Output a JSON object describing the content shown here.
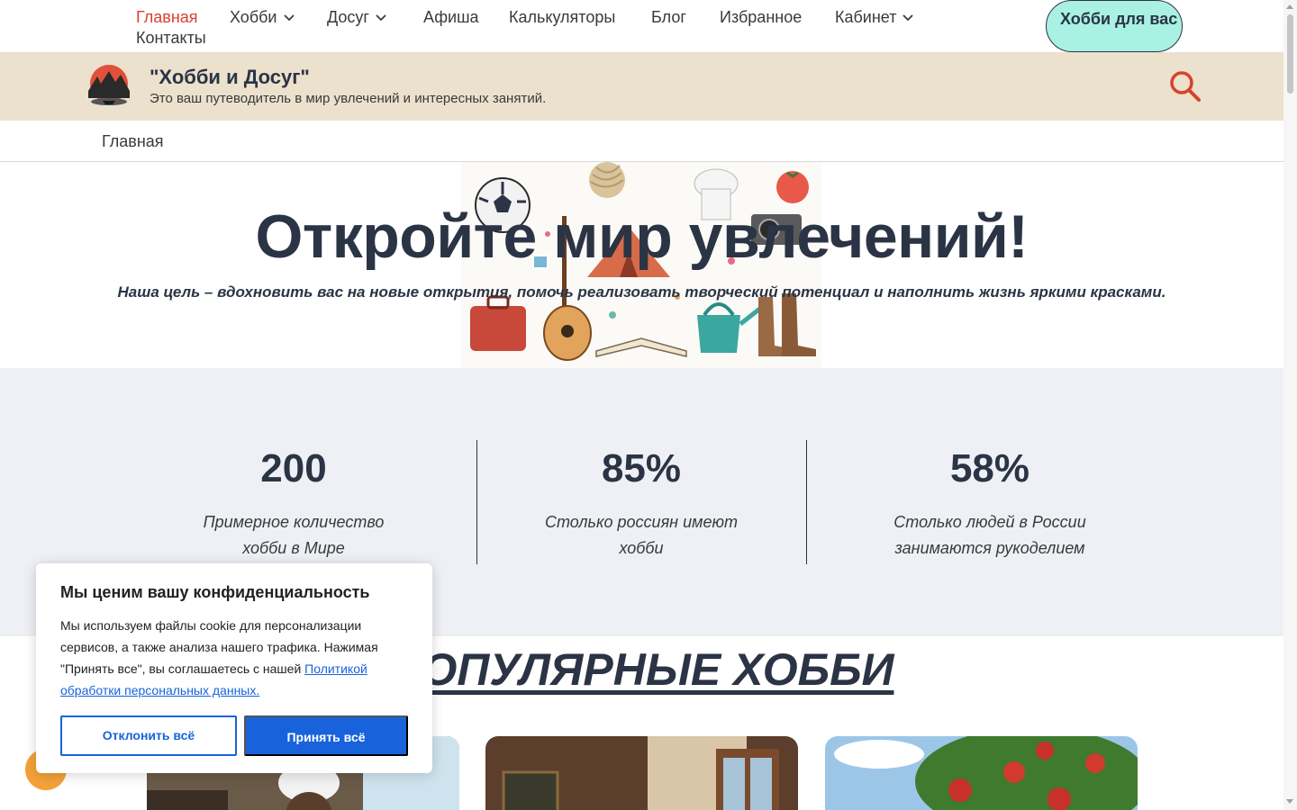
{
  "nav": {
    "items": [
      {
        "label": "Главная",
        "active": true
      },
      {
        "label": "Хобби",
        "has_dropdown": true
      },
      {
        "label": "Досуг",
        "has_dropdown": true
      },
      {
        "label": "Афиша"
      },
      {
        "label": "Калькуляторы"
      },
      {
        "label": "Блог"
      },
      {
        "label": "Избранное"
      },
      {
        "label": "Кабинет",
        "has_dropdown": true
      },
      {
        "label": "Контакты"
      }
    ],
    "cta_label": "Хобби для вас"
  },
  "header": {
    "site_title": "\"Хобби и Досуг\"",
    "site_description": "Это ваш путеводитель в мир увлечений и интересных занятий.",
    "search_icon": "search-icon"
  },
  "breadcrumb": {
    "home": "Главная"
  },
  "hero": {
    "title": "Откройте мир увлечений!",
    "subtitle": "Наша цель – вдохновить вас на новые открытия, помочь реализовать творческий потенциал и наполнить жизнь яркими красками."
  },
  "stats": [
    {
      "value": "200",
      "label_line1": "Примерное количество",
      "label_line2": "хобби в Мире"
    },
    {
      "value": "85%",
      "label_line1": "Столько россиян имеют",
      "label_line2": "хобби"
    },
    {
      "value": "58%",
      "label_line1": "Столько людей в России",
      "label_line2": "занимаются рукоделием"
    }
  ],
  "popular": {
    "title": "ПОПУЛЯРНЫЕ ХОББИ"
  },
  "cookie": {
    "title": "Мы ценим вашу конфиденциальность",
    "text": "Мы используем файлы cookie для персонализации сервисов, а также анализа нашего трафика. Нажимая \"Принять все\", вы соглашаетесь с нашей ",
    "link": "Политикой обработки персональных данных.",
    "reject_label": "Отклонить всё",
    "accept_label": "Принять всё"
  },
  "colors": {
    "accent_active": "#d9412b",
    "cta_bg": "#a9f1e3",
    "header_bg": "#ebe1cd",
    "stats_bg": "#eef0f6",
    "cookie_button": "#1863dc",
    "text_dark": "#2b3445"
  }
}
